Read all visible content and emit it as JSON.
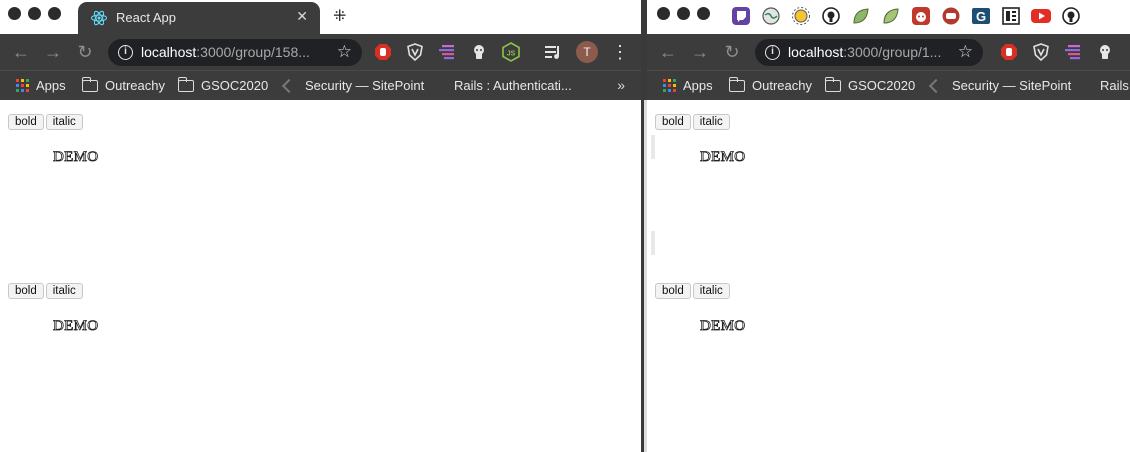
{
  "left_window": {
    "tab": {
      "title": "React App",
      "close": "✕"
    },
    "new_tab_glyph": "⁜",
    "toolbar": {
      "back": "←",
      "forward": "→",
      "reload": "↻",
      "url_host": "localhost",
      "url_path": ":3000/group/158...",
      "star": "☆",
      "profile_initial": "T",
      "menu": "⋮"
    },
    "bookmarks": [
      {
        "label": "Apps",
        "icon": "apps-grid-icon"
      },
      {
        "label": "Outreachy",
        "icon": "folder-icon"
      },
      {
        "label": "GSOC2020",
        "icon": "folder-icon"
      },
      {
        "label": "Security — SitePoint",
        "icon": "sitepoint-icon"
      },
      {
        "label": "Rails : Authenticati...",
        "icon": "none"
      }
    ],
    "bookmarks_overflow": "»",
    "editors": [
      {
        "bold_label": "bold",
        "italic_label": "italic",
        "text": "DEMO"
      },
      {
        "bold_label": "bold",
        "italic_label": "italic",
        "text": "DEMO"
      }
    ]
  },
  "right_window": {
    "toolbar": {
      "back": "←",
      "forward": "→",
      "reload": "↻",
      "url_host": "localhost",
      "url_path": ":3000/group/1...",
      "star": "☆"
    },
    "bookmarks": [
      {
        "label": "Apps",
        "icon": "apps-grid-icon"
      },
      {
        "label": "Outreachy",
        "icon": "folder-icon"
      },
      {
        "label": "GSOC2020",
        "icon": "folder-icon"
      },
      {
        "label": "Security — SitePoint",
        "icon": "sitepoint-icon"
      },
      {
        "label": "Rails",
        "icon": "none"
      }
    ],
    "editors": [
      {
        "bold_label": "bold",
        "italic_label": "italic",
        "text": "DEMO"
      },
      {
        "bold_label": "bold",
        "italic_label": "italic",
        "text": "DEMO"
      }
    ],
    "extension_icons": [
      "twitch-icon",
      "globe-icon",
      "sun-icon",
      "github-icon",
      "leaf-icon",
      "leaf-icon",
      "reddit-icon",
      "chat-icon",
      "g-icon",
      "news-icon",
      "youtube-icon",
      "github-icon"
    ]
  },
  "colors": {
    "chrome_dark": "#3c3c3c",
    "omnibox": "#202124",
    "accent_red": "#d93025",
    "js_green": "#8bc34a",
    "profile_brown": "#8d5b4c"
  }
}
